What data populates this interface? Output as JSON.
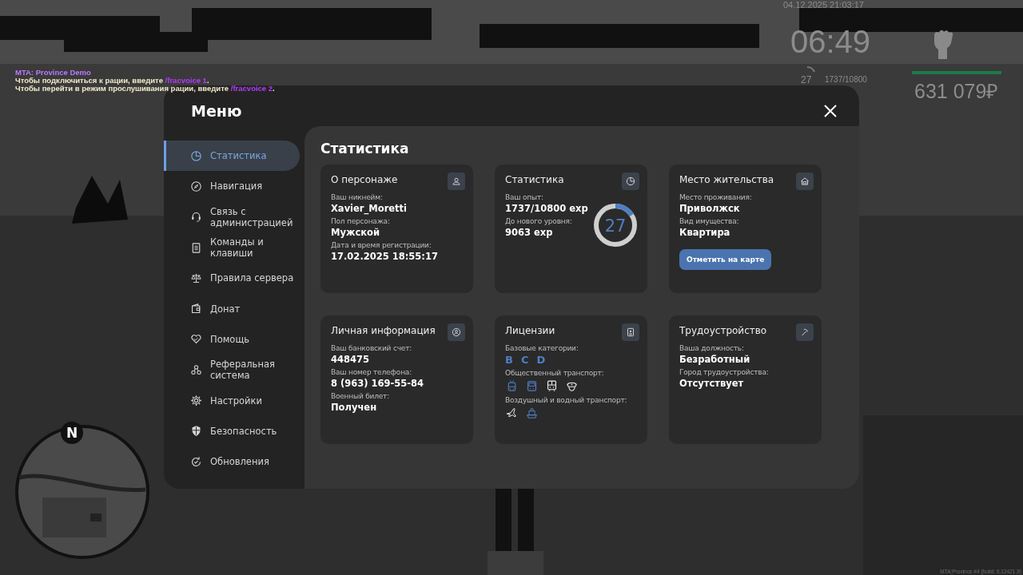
{
  "chat": [
    {
      "text": "MTA: Province Demo",
      "kind": "title"
    },
    {
      "text": "Чтобы подключиться к рации, введите ",
      "command": "/fracvoice 1",
      "end": ".",
      "kind": "line"
    },
    {
      "text": "Чтобы перейти в режим прослушивания рации, введите ",
      "command": "/fracvoice 2",
      "end": ".",
      "kind": "line"
    }
  ],
  "hud": {
    "datetime": "04.12.2025 21:03:17",
    "time": "06:49",
    "level": "27",
    "experience": "1737/10800",
    "money": "631 079₽"
  },
  "minimap": {
    "north": "N"
  },
  "build": "MTA:Province #4 (build: 6.12421.9)",
  "menu": {
    "title": "Меню",
    "sidebar": {
      "items": [
        {
          "label": "Статистика",
          "selected": true
        },
        {
          "label": "Навигация",
          "selected": false
        },
        {
          "label": "Связь с администрацией",
          "selected": false
        },
        {
          "label": "Команды и клавиши",
          "selected": false
        },
        {
          "label": "Правила сервера",
          "selected": false
        },
        {
          "label": "Донат",
          "selected": false
        },
        {
          "label": "Помощь",
          "selected": false
        },
        {
          "label": "Реферальная система",
          "selected": false
        },
        {
          "label": "Настройки",
          "selected": false
        },
        {
          "label": "Безопасность",
          "selected": false
        },
        {
          "label": "Обновления",
          "selected": false
        }
      ]
    },
    "content": {
      "title": "Статистика",
      "cards": [
        {
          "title": "О персонаже",
          "kind": "fields",
          "fields": [
            {
              "label": "Ваш никнейм:",
              "value": "Xavier_Moretti"
            },
            {
              "label": "Пол персонажа:",
              "value": "Мужской"
            },
            {
              "label": "Дата и время регистрации:",
              "value": "17.02.2025 18:55:17"
            }
          ]
        },
        {
          "title": "Статистика",
          "kind": "level",
          "fields": [
            {
              "label": "Ваш опыт:",
              "value": "1737/10800 exp"
            },
            {
              "label": "До нового уровня:",
              "value": "9063 exp"
            }
          ],
          "ring": {
            "value": "27",
            "level": 0.16
          }
        },
        {
          "title": "Место жительства",
          "kind": "fields",
          "fields": [
            {
              "label": "Место проживания:",
              "value": "Приволжск"
            },
            {
              "label": "Вид имущества:",
              "value": "Квартира"
            }
          ],
          "button": "Отметить на карте"
        },
        {
          "title": "Личная информация",
          "kind": "fields",
          "fields": [
            {
              "label": "Ваш банковский счет:",
              "value": "448475"
            },
            {
              "label": "Ваш номер телефона:",
              "value": "8 (963) 169-55-84"
            },
            {
              "label": "Военный билет:",
              "value": "Получен"
            }
          ]
        },
        {
          "title": "Лицензии",
          "kind": "licenses",
          "sections": [
            {
              "label": "Базовые категории:",
              "kind": "letters",
              "items": [
                "B",
                "C",
                "D"
              ]
            },
            {
              "label": "Общественный транспорт:",
              "kind": "icons",
              "items": [
                {
                  "kind": "trolleybus",
                  "highlighted": true
                },
                {
                  "kind": "bus",
                  "highlighted": true
                },
                {
                  "kind": "train",
                  "highlighted": false
                },
                {
                  "kind": "cap",
                  "highlighted": false
                }
              ]
            },
            {
              "label": "Воздушный и водный транспорт:",
              "kind": "icons",
              "items": [
                {
                  "kind": "plane",
                  "highlighted": false
                },
                {
                  "kind": "ship",
                  "highlighted": true
                }
              ]
            }
          ]
        },
        {
          "title": "Трудоустройство",
          "kind": "fields",
          "fields": [
            {
              "label": "Ваша должность:",
              "value": "Безработный"
            },
            {
              "label": "Город трудоустройства:",
              "value": "Отсутствует"
            }
          ]
        }
      ]
    }
  }
}
